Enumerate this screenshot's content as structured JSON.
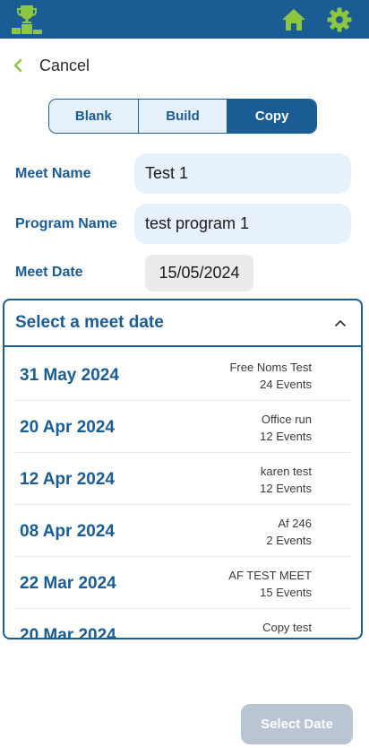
{
  "header": {
    "logo_icon": "trophy-podium-icon",
    "home_icon": "home-icon",
    "settings_icon": "gear-icon",
    "accent_color": "#8dc63f",
    "bar_color": "#1a5d94"
  },
  "back": {
    "label": "Cancel",
    "icon": "chevron-left-icon"
  },
  "mode_tabs": [
    {
      "label": "Blank",
      "active": false
    },
    {
      "label": "Build",
      "active": false
    },
    {
      "label": "Copy",
      "active": true
    }
  ],
  "form": {
    "meet_name_label": "Meet Name",
    "meet_name_value": "Test 1",
    "program_name_label": "Program Name",
    "program_name_value": "test program 1",
    "meet_date_label": "Meet Date",
    "meet_date_value": "15/05/2024"
  },
  "picker": {
    "title": "Select a meet date",
    "caret_icon": "chevron-up-icon",
    "items": [
      {
        "date": "31 May 2024",
        "meet": "Free Noms Test",
        "events": "24 Events"
      },
      {
        "date": "20 Apr 2024",
        "meet": "Office run",
        "events": "12 Events"
      },
      {
        "date": "12 Apr 2024",
        "meet": "karen test",
        "events": "12 Events"
      },
      {
        "date": "08 Apr 2024",
        "meet": "Af 246",
        "events": "2 Events"
      },
      {
        "date": "22 Mar 2024",
        "meet": "AF TEST MEET",
        "events": "15 Events"
      },
      {
        "date": "20 Mar 2024",
        "meet": "Copy test",
        "events": ""
      }
    ]
  },
  "footer": {
    "select_label": "Select Date",
    "disabled": true
  }
}
